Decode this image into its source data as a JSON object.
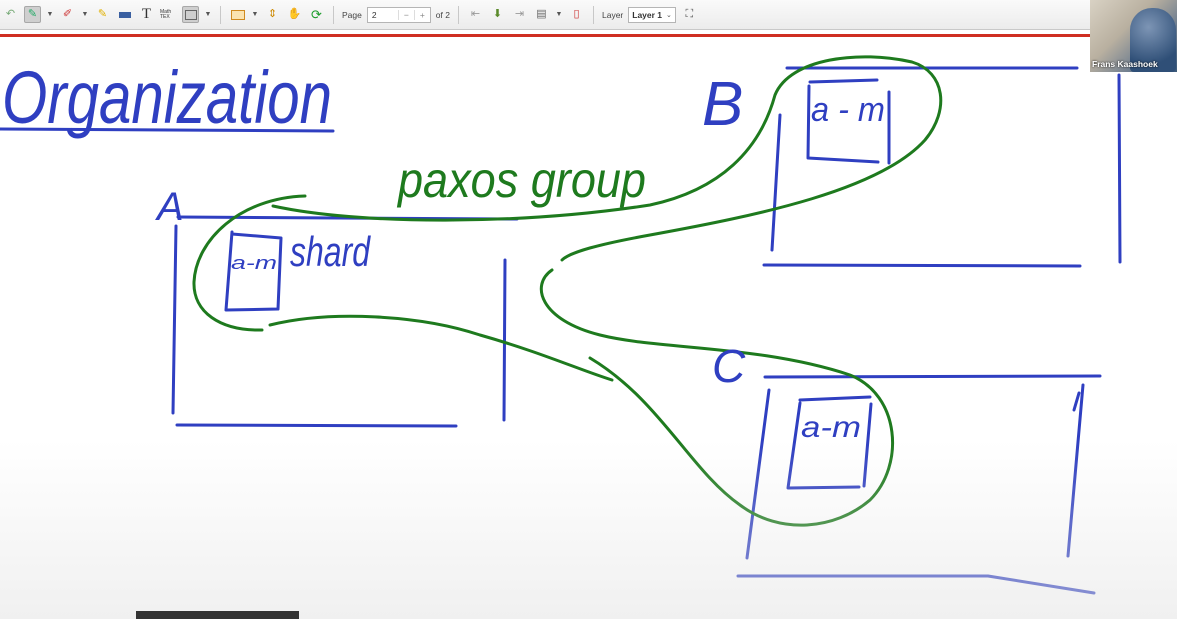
{
  "toolbar": {
    "tools": [
      {
        "name": "undo-icon",
        "glyph": "↶"
      },
      {
        "name": "pen-tool-icon",
        "glyph": "✎",
        "active": true
      },
      {
        "name": "eraser-icon",
        "glyph": "⌫"
      },
      {
        "name": "highlighter-icon",
        "glyph": "▰"
      },
      {
        "name": "text-tool-icon",
        "glyph": "T"
      },
      {
        "name": "math-tex-icon",
        "glyph": "∑"
      }
    ],
    "math_label": "Math TEX",
    "page_label": "Page",
    "page_value": "2",
    "page_minus": "−",
    "page_plus": "+",
    "page_total": "of 2",
    "layer_label": "Layer",
    "layer_value": "Layer 1"
  },
  "drawing": {
    "title": "Organization",
    "label_a": "A",
    "label_b": "B",
    "label_c": "C",
    "shard_range_a": "a-m",
    "shard_range_b": "a - m",
    "shard_range_c": "a-m",
    "shard_label": "shard",
    "group_label": "paxos group",
    "ink_blue": "#2f3fc1",
    "ink_green": "#1e7a1e"
  },
  "video": {
    "participant_name": "Frans Kaashoek"
  }
}
